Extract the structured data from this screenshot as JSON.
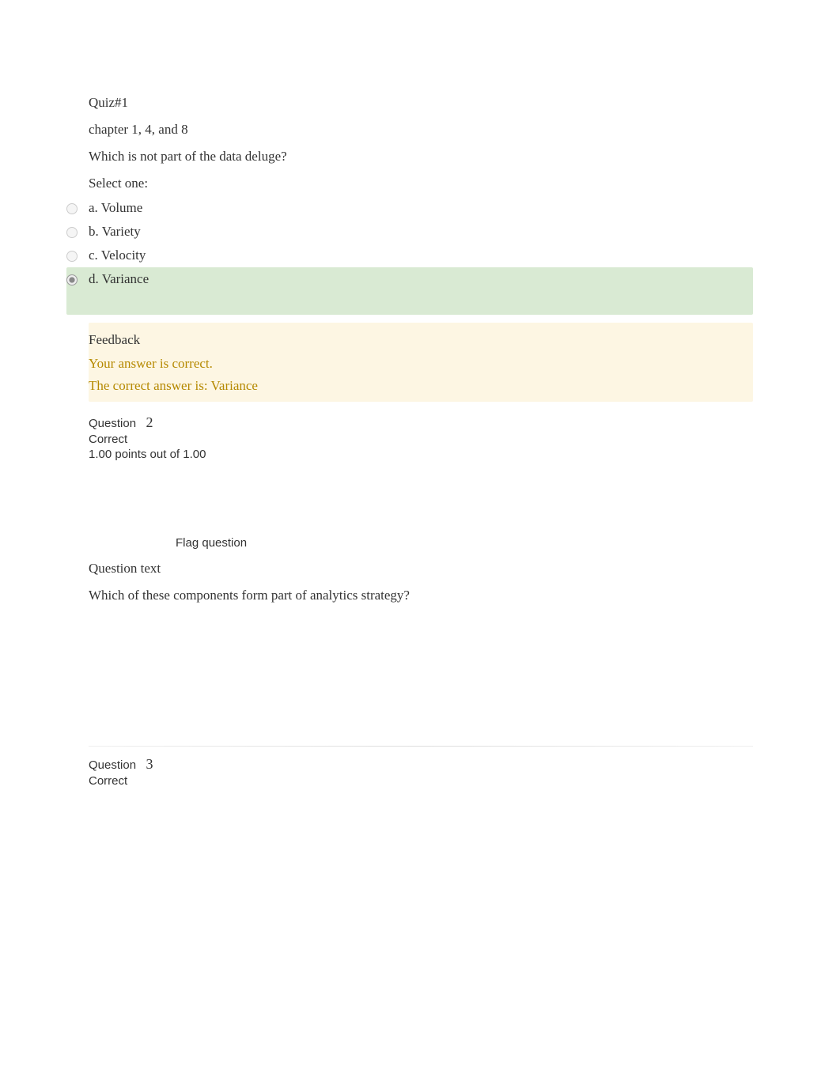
{
  "quiz": {
    "title": "Quiz#1",
    "subtitle": "chapter 1, 4, and 8"
  },
  "q1": {
    "prompt": "Which is not part of the data deluge?",
    "select_label": "Select one:",
    "options": {
      "a": "a. Volume",
      "b": "b. Variety",
      "c": "c. Velocity",
      "d": "d. Variance"
    },
    "feedback": {
      "title": "Feedback",
      "correct_msg": "Your answer is correct.",
      "answer_msg": "The correct answer is: Variance"
    }
  },
  "q2": {
    "meta": {
      "label": "Question",
      "number": "2",
      "status": "Correct",
      "points": "1.00 points out of 1.00"
    },
    "flag_label": "Flag question",
    "text_label": "Question text",
    "prompt": "Which of these components form part of analytics strategy?"
  },
  "q3": {
    "meta": {
      "label": "Question",
      "number": "3",
      "status": "Correct"
    }
  }
}
